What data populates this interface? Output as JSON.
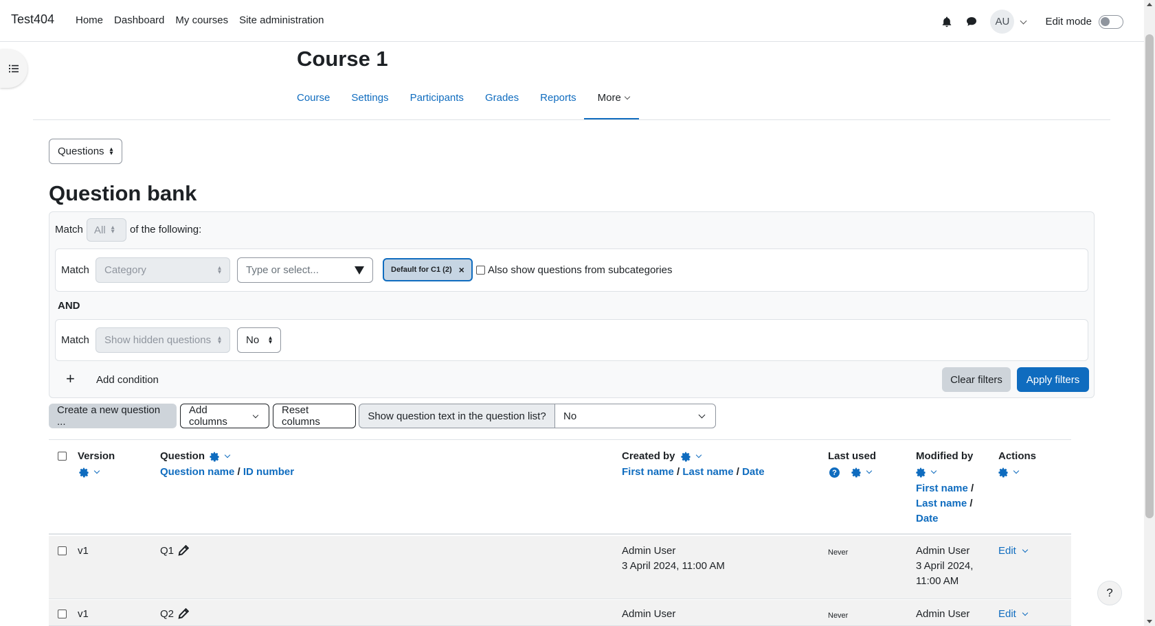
{
  "navbar": {
    "brand": "Test404",
    "items": [
      "Home",
      "Dashboard",
      "My courses",
      "Site administration"
    ],
    "avatar_initials": "AU",
    "edit_mode_label": "Edit mode"
  },
  "course": {
    "title": "Course 1",
    "tabs": [
      "Course",
      "Settings",
      "Participants",
      "Grades",
      "Reports",
      "More"
    ]
  },
  "bank_selector": "Questions",
  "page_title": "Question bank",
  "filters": {
    "match_prefix": "Match",
    "match_value": "All",
    "match_suffix": "of the following:",
    "row1": {
      "match_label": "Match",
      "type": "Category",
      "search_placeholder": "Type or select...",
      "pill": "Default for C1 (2)",
      "pill_remove": "×",
      "subcat_label": "Also show questions from subcategories"
    },
    "join": "AND",
    "row2": {
      "match_label": "Match",
      "type": "Show hidden questions",
      "value": "No"
    },
    "add_condition": "Add condition",
    "clear": "Clear filters",
    "apply": "Apply filters"
  },
  "toolbar": {
    "create": "Create a new question ...",
    "add_columns": "Add columns",
    "reset_columns": "Reset columns",
    "show_text_label": "Show question text in the question list?",
    "show_text_value": "No"
  },
  "table": {
    "headers": {
      "version": "Version",
      "question": "Question",
      "question_name": "Question name",
      "id_number": "ID number",
      "created_by": "Created by",
      "first_name": "First name",
      "last_name": "Last name",
      "date": "Date",
      "last_used": "Last used",
      "modified_by": "Modified by",
      "actions": "Actions",
      "sep": "/"
    },
    "rows": [
      {
        "version": "v1",
        "question": "Q1",
        "created_name": "Admin User",
        "created_date": "3 April 2024, 11:00 AM",
        "last_used": "Never",
        "modified_name": "Admin User",
        "modified_date_1": "3 April 2024,",
        "modified_date_2": "11:00 AM",
        "action": "Edit"
      },
      {
        "version": "v1",
        "question": "Q2",
        "created_name": "Admin User",
        "last_used": "Never",
        "modified_name": "Admin User",
        "action": "Edit"
      }
    ]
  },
  "help_button": "?",
  "colors": {
    "accent": "#0f6cbf",
    "row_bg": "#f2f2f2",
    "filter_bg": "#f8f9fa"
  }
}
